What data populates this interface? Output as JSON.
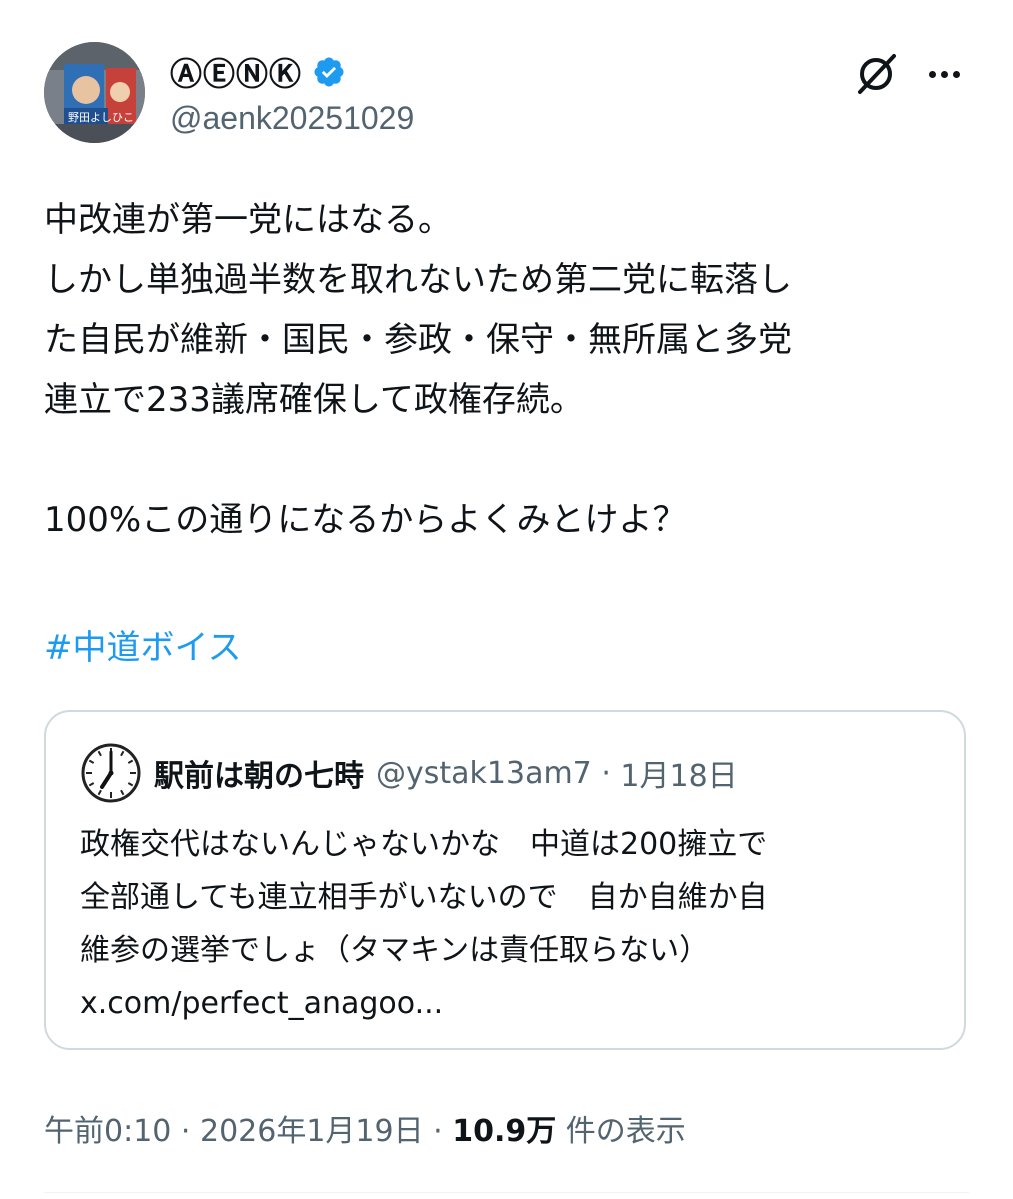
{
  "author": {
    "display_name": "ⒶⒺⓃⓀ",
    "handle": "@aenk20251029",
    "avatar_caption": "野田よしひこ"
  },
  "actions": {
    "grok_icon": "grok-icon",
    "more_icon": "more-horizontal-icon"
  },
  "post": {
    "lines": [
      "中改連が第一党にはなる。",
      "しかし単独過半数を取れないため第二党に転落し",
      "た自民が維新・国民・参政・保守・無所属と多党",
      "連立で233議席確保して政権存続。",
      "100%この通りになるからよくみとけよ？"
    ],
    "hashtag": "#中道ボイス"
  },
  "quoted_post": {
    "display_name": "駅前は朝の七時",
    "handle": "@ystak13am7",
    "separator": " · ",
    "date": "1月18日",
    "lines": [
      "政権交代はないんじゃないかな　中道は200擁立で",
      "全部通しても連立相手がいないので　自か自維か自",
      "維参の選挙でしょ（タマキンは責任取らない）",
      "x.com/perfect_anagoo..."
    ]
  },
  "meta": {
    "time": "午前0:10",
    "sep1": " · ",
    "date": "2026年1月19日",
    "sep2": " · ",
    "views_count": "10.9万",
    "views_label": " 件の表示"
  },
  "colors": {
    "text": "#0f1419",
    "secondary": "#536471",
    "link": "#1d9bf0",
    "verified": "#1d9bf0",
    "border": "#cfd9de"
  }
}
